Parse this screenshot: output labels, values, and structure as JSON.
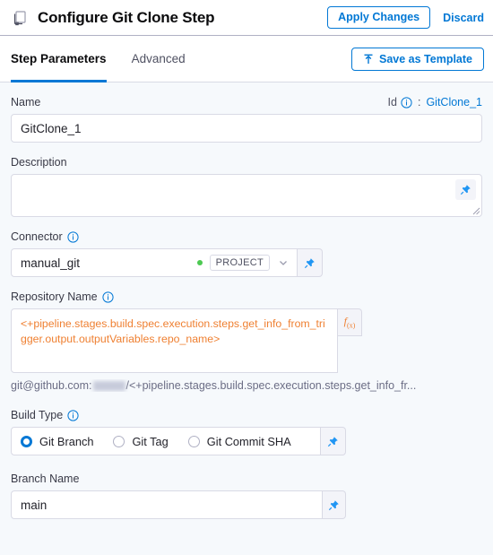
{
  "header": {
    "icon": "clone-step-icon",
    "title": "Configure Git Clone Step",
    "apply_label": "Apply Changes",
    "discard_label": "Discard"
  },
  "tabs": [
    {
      "label": "Step Parameters",
      "active": true
    },
    {
      "label": "Advanced",
      "active": false
    }
  ],
  "toolbar": {
    "save_template_label": "Save as Template"
  },
  "form": {
    "name": {
      "label": "Name",
      "id_label": "Id",
      "id_separator": ":",
      "id_value": "GitClone_1",
      "value": "GitClone_1"
    },
    "description": {
      "label": "Description",
      "value": "",
      "placeholder": ""
    },
    "connector": {
      "label": "Connector",
      "value": "manual_git",
      "scope_tag": "PROJECT",
      "status_color": "#4dc952"
    },
    "repository_name": {
      "label": "Repository Name",
      "value": "<+pipeline.stages.build.spec.execution.steps.get_info_from_trigger.output.outputVariables.repo_name>",
      "fx_label": "f(x)",
      "helper_prefix": "git@github.com:",
      "helper_redacted": "",
      "helper_suffix": "/<+pipeline.stages.build.spec.execution.steps.get_info_fr..."
    },
    "build_type": {
      "label": "Build Type",
      "selected": "Git Branch",
      "options": [
        {
          "label": "Git Branch"
        },
        {
          "label": "Git Tag"
        },
        {
          "label": "Git Commit SHA"
        }
      ]
    },
    "branch_name": {
      "label": "Branch Name",
      "value": "main"
    }
  },
  "colors": {
    "accent": "#0278d5",
    "expression": "#ef8032",
    "status_ok": "#4dc952",
    "page_bg": "#f6f9fc"
  }
}
